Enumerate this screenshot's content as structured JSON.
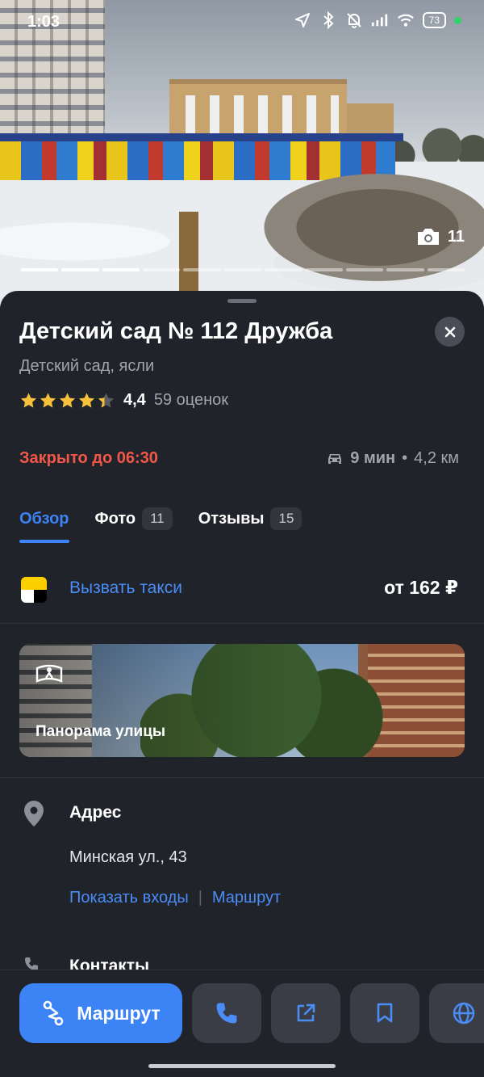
{
  "status_bar": {
    "time": "1:03",
    "battery": "73"
  },
  "hero": {
    "photo_count": "11",
    "progress_segments": 11,
    "progress_active": 3
  },
  "place": {
    "title": "Детский сад № 112 Дружба",
    "category": "Детский сад, ясли",
    "rating": "4,4",
    "rating_value": 4.4,
    "reviews_count": "59 оценок",
    "status": "Закрыто до 06:30",
    "drive_time": "9 мин",
    "distance": "4,2 км"
  },
  "tabs": [
    {
      "label": "Обзор",
      "badge": ""
    },
    {
      "label": "Фото",
      "badge": "11"
    },
    {
      "label": "Отзывы",
      "badge": "15"
    }
  ],
  "taxi": {
    "label": "Вызвать такси",
    "price": "от 162 ₽"
  },
  "panorama": {
    "label": "Панорама улицы"
  },
  "address": {
    "heading": "Адрес",
    "text": "Минская ул., 43",
    "link_entrances": "Показать входы",
    "link_route": "Маршрут"
  },
  "contacts": {
    "heading": "Контакты"
  },
  "bottom_bar": {
    "route_label": "Маршрут"
  },
  "colors": {
    "accent": "#3c83f5",
    "closed": "#f2584a",
    "background": "#21232a",
    "star": "#f7c13b"
  }
}
